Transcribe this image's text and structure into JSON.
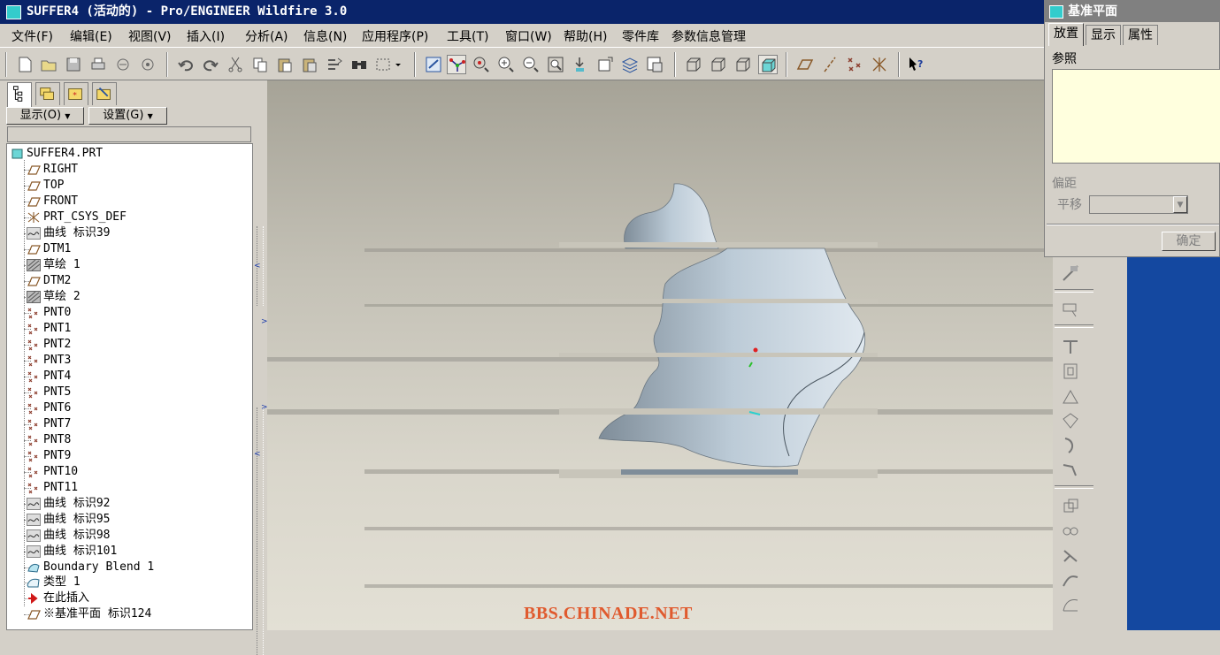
{
  "window": {
    "title": "SUFFER4 (活动的) - Pro/ENGINEER Wildfire 3.0"
  },
  "menu": [
    "文件(F)",
    "编辑(E)",
    "视图(V)",
    "插入(I)",
    "分析(A)",
    "信息(N)",
    "应用程序(P)",
    "工具(T)",
    "窗口(W)",
    "帮助(H)",
    "零件库",
    "参数信息管理"
  ],
  "toolbar": {
    "icons": [
      "new-icon",
      "open-icon",
      "save-icon",
      "print-icon",
      "send-icon",
      "email-icon",
      "undo-icon",
      "redo-icon",
      "cut-icon",
      "copy-icon",
      "paste-icon",
      "paste-special-icon",
      "regenerate-icon",
      "find-icon",
      "select-box-icon",
      "repaint-icon",
      "spin-center-icon",
      "orient-icon",
      "zoom-in-icon",
      "zoom-out-icon",
      "refit-icon",
      "reorient-icon",
      "saved-views-icon",
      "layers-icon",
      "view-manager-icon",
      "wireframe-icon",
      "hidden-line-icon",
      "no-hidden-icon",
      "shading-icon",
      "datum-planes-icon",
      "datum-axes-icon",
      "datum-points-icon",
      "coordinate-systems-icon",
      "context-help-icon"
    ]
  },
  "left_panel": {
    "tabs": [
      "model-tree-tab",
      "layer-tree-tab",
      "favorites-tab",
      "connections-tab"
    ],
    "show_label": "显示(O)",
    "settings_label": "设置(G)"
  },
  "model_tree": {
    "root": "SUFFER4.PRT",
    "items": [
      {
        "label": "RIGHT",
        "icon": "datum-plane-icon"
      },
      {
        "label": "TOP",
        "icon": "datum-plane-icon"
      },
      {
        "label": "FRONT",
        "icon": "datum-plane-icon"
      },
      {
        "label": "PRT_CSYS_DEF",
        "icon": "csys-icon"
      },
      {
        "label": "曲线 标识39",
        "icon": "curve-icon"
      },
      {
        "label": "DTM1",
        "icon": "datum-plane-icon"
      },
      {
        "label": "草绘 1",
        "icon": "sketch-icon"
      },
      {
        "label": "DTM2",
        "icon": "datum-plane-icon"
      },
      {
        "label": "草绘 2",
        "icon": "sketch-icon"
      },
      {
        "label": "PNT0",
        "icon": "datum-point-icon"
      },
      {
        "label": "PNT1",
        "icon": "datum-point-icon"
      },
      {
        "label": "PNT2",
        "icon": "datum-point-icon"
      },
      {
        "label": "PNT3",
        "icon": "datum-point-icon"
      },
      {
        "label": "PNT4",
        "icon": "datum-point-icon"
      },
      {
        "label": "PNT5",
        "icon": "datum-point-icon"
      },
      {
        "label": "PNT6",
        "icon": "datum-point-icon"
      },
      {
        "label": "PNT7",
        "icon": "datum-point-icon"
      },
      {
        "label": "PNT8",
        "icon": "datum-point-icon"
      },
      {
        "label": "PNT9",
        "icon": "datum-point-icon"
      },
      {
        "label": "PNT10",
        "icon": "datum-point-icon"
      },
      {
        "label": "PNT11",
        "icon": "datum-point-icon"
      },
      {
        "label": "曲线 标识92",
        "icon": "curve-icon"
      },
      {
        "label": "曲线 标识95",
        "icon": "curve-icon"
      },
      {
        "label": "曲线 标识98",
        "icon": "curve-icon"
      },
      {
        "label": "曲线 标识101",
        "icon": "curve-icon"
      },
      {
        "label": "Boundary Blend 1",
        "icon": "boundary-blend-icon"
      },
      {
        "label": "类型 1",
        "icon": "surface-icon"
      },
      {
        "label": "在此插入",
        "icon": "insert-here-icon"
      },
      {
        "label": "※基准平面 标识124",
        "icon": "datum-plane-icon"
      }
    ]
  },
  "viewport": {
    "watermark": "BBS.CHINADE.NET"
  },
  "dialog": {
    "title": "基准平面",
    "tabs": [
      "放置",
      "显示",
      "属性"
    ],
    "references_label": "参照",
    "offset_label": "偏距",
    "translation_label": "平移",
    "ok_label": "确定"
  },
  "right_tools": [
    "datum-axis-tool-icon",
    "sketch-tool-icon",
    "extrude-tool-icon",
    "hole-tool-icon",
    "shell-tool-icon",
    "rib-tool-icon",
    "draft-tool-icon",
    "round-tool-icon",
    "chamfer-tool-icon",
    "pattern-tool-icon",
    "mirror-tool-icon",
    "merge-tool-icon",
    "trim-tool-icon",
    "offset-tool-icon"
  ],
  "colors": {
    "titlebar": "#0a246a",
    "dialog_titlebar": "#808080",
    "chrome": "#d4d0c8",
    "ref_box": "#ffffde",
    "surface": "#bccbd7",
    "watermark": "#e05a2e",
    "side_blue": "#1448a0"
  }
}
